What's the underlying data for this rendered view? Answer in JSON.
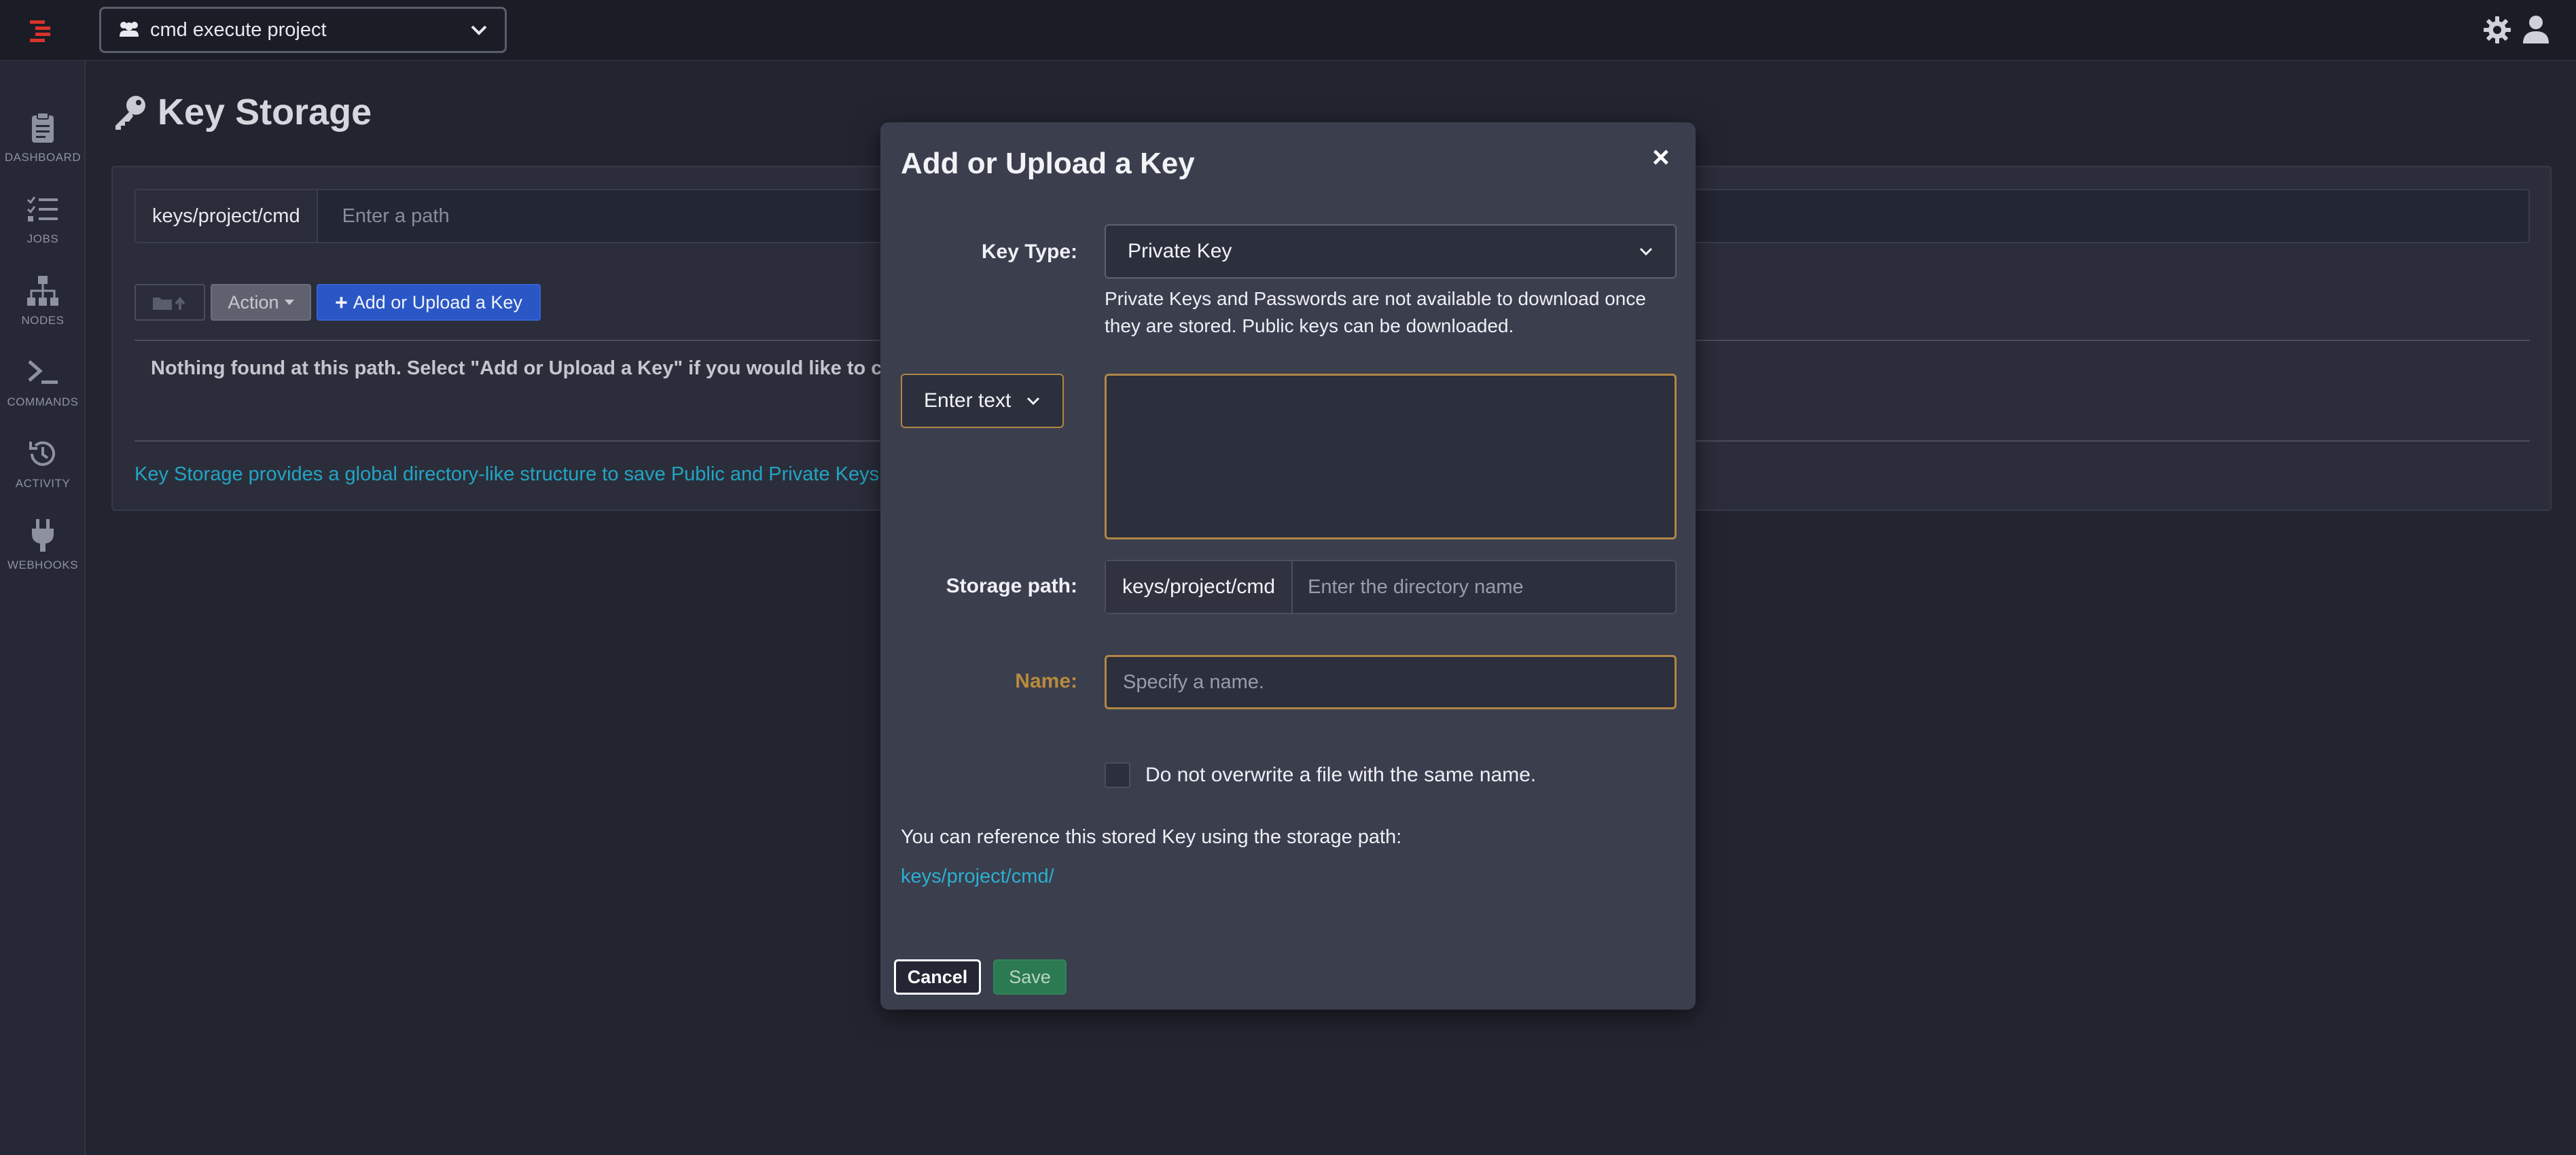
{
  "header": {
    "project": "cmd execute project",
    "icons": [
      "logo-icon",
      "users-icon",
      "chevron-down-icon",
      "gear-icon",
      "user-icon"
    ]
  },
  "sidebar": {
    "items": [
      {
        "label": "DASHBOARD",
        "icon": "clipboard-icon"
      },
      {
        "label": "JOBS",
        "icon": "checklist-icon"
      },
      {
        "label": "NODES",
        "icon": "sitemap-icon"
      },
      {
        "label": "COMMANDS",
        "icon": "terminal-icon"
      },
      {
        "label": "ACTIVITY",
        "icon": "history-icon"
      },
      {
        "label": "WEBHOOKS",
        "icon": "plug-icon"
      }
    ]
  },
  "page": {
    "title": "Key Storage",
    "path_prefix": "keys/project/cmd",
    "path_placeholder": "Enter a path",
    "action_label": "Action",
    "add_label": "Add or Upload a Key",
    "empty_message": "Nothing found at this path. Select \"Add or Upload a Key\" if you would like to crea",
    "info_text": "Key Storage provides a global directory-like structure to save Public and Private Keys"
  },
  "modal": {
    "title": "Add or Upload a Key",
    "close": "×",
    "key_type_label": "Key Type:",
    "key_type_value": "Private Key",
    "help_text": "Private Keys and Passwords are not available to download once they are stored. Public keys can be downloaded.",
    "entry_mode": "Enter text",
    "storage_label": "Storage path:",
    "storage_prefix": "keys/project/cmd",
    "storage_placeholder": "Enter the directory name",
    "name_label": "Name:",
    "name_placeholder": "Specify a name.",
    "overwrite_label": "Do not overwrite a file with the same name.",
    "reference_text": "You can reference this stored Key using the storage path:",
    "reference_path": "keys/project/cmd/",
    "cancel_label": "Cancel",
    "save_label": "Save"
  },
  "colors": {
    "accent_blue": "#2a57c5",
    "link": "#22a4c4",
    "warning": "#b08745",
    "save_green": "#2c7a52",
    "logo_red": "#d9332b"
  }
}
